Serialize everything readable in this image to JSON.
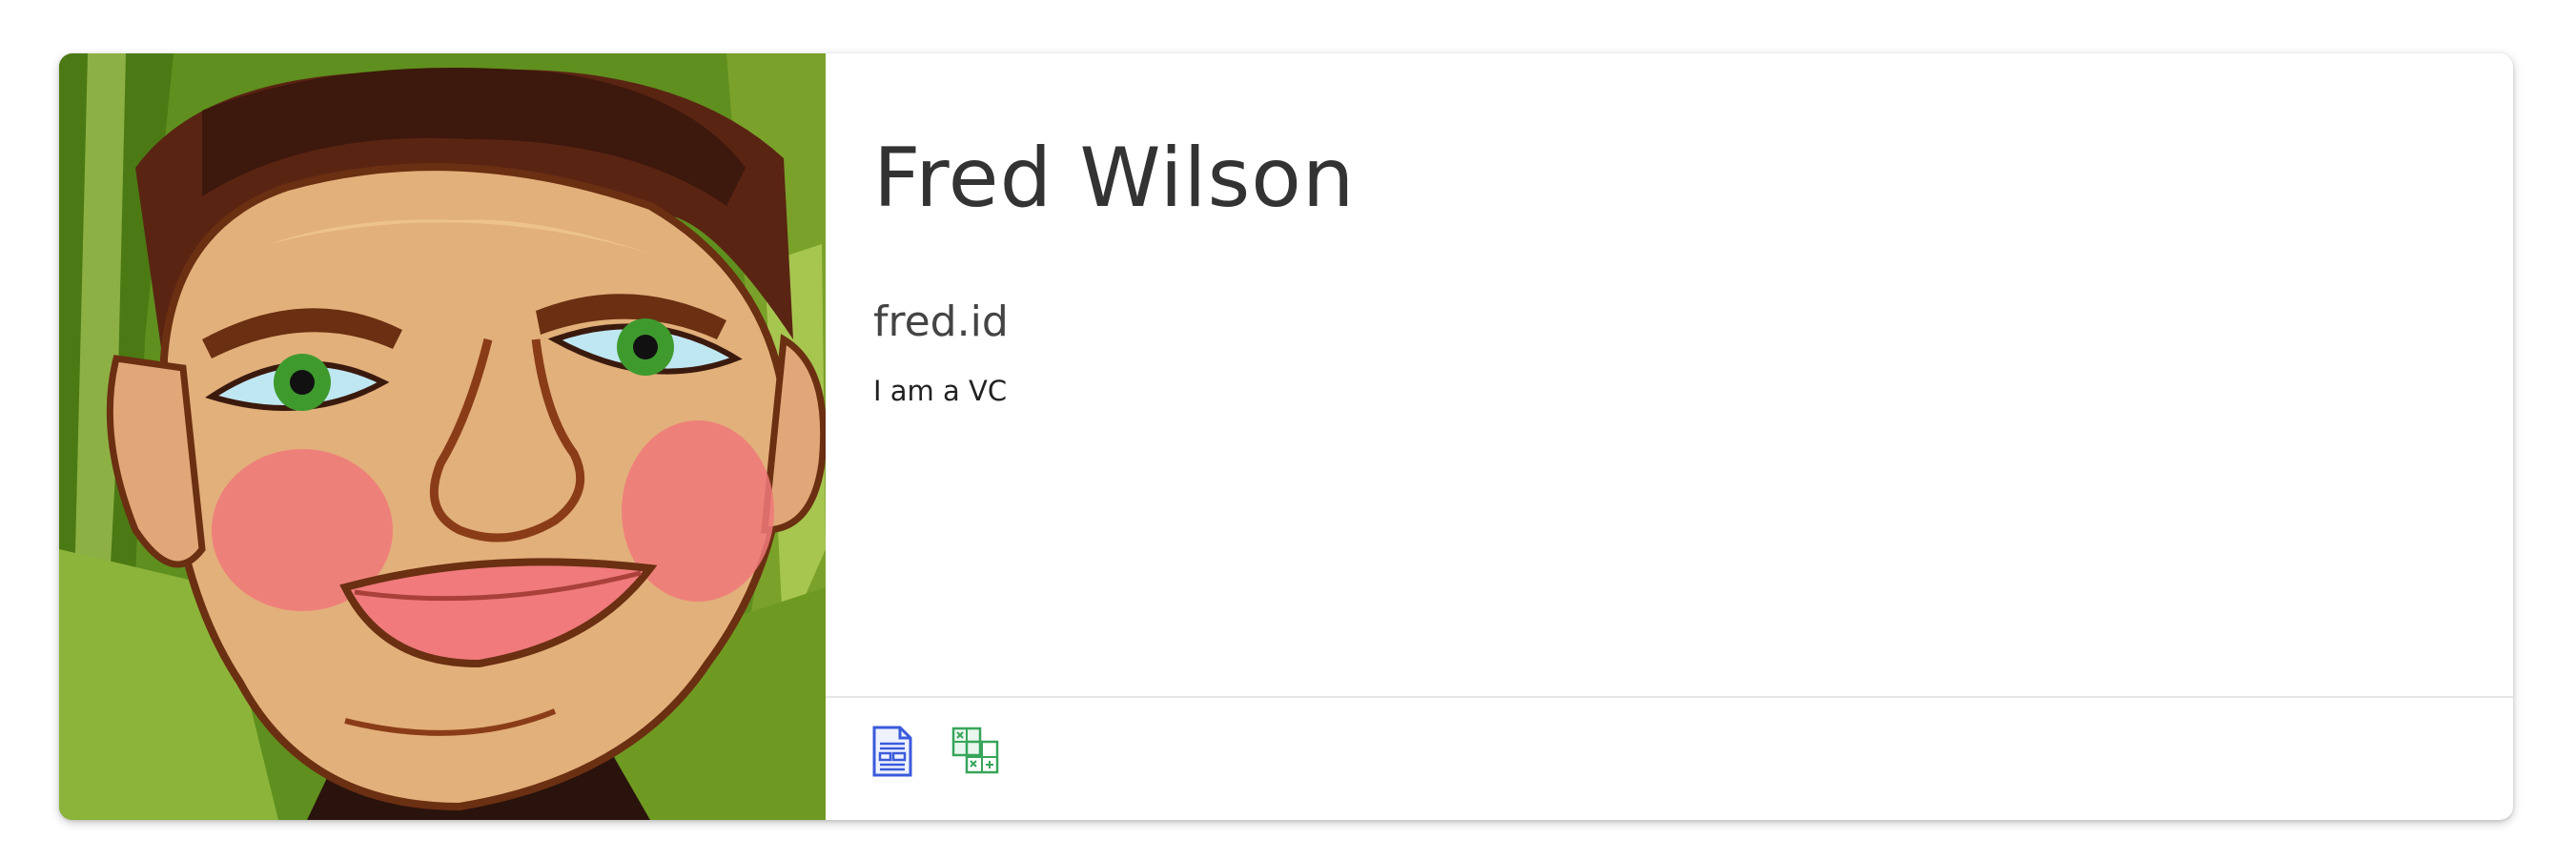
{
  "profile": {
    "name": "Fred Wilson",
    "handle": "fred.id",
    "bio": "I am a VC",
    "avatar_icon": "portrait-painting"
  },
  "apps": [
    {
      "icon": "document-app-icon",
      "color": "#3b5bdb"
    },
    {
      "icon": "spreadsheet-app-icon",
      "color": "#37a55a"
    }
  ],
  "colors": {
    "card_background": "#ffffff",
    "name_text": "#333333",
    "divider": "#e6e6e6"
  }
}
